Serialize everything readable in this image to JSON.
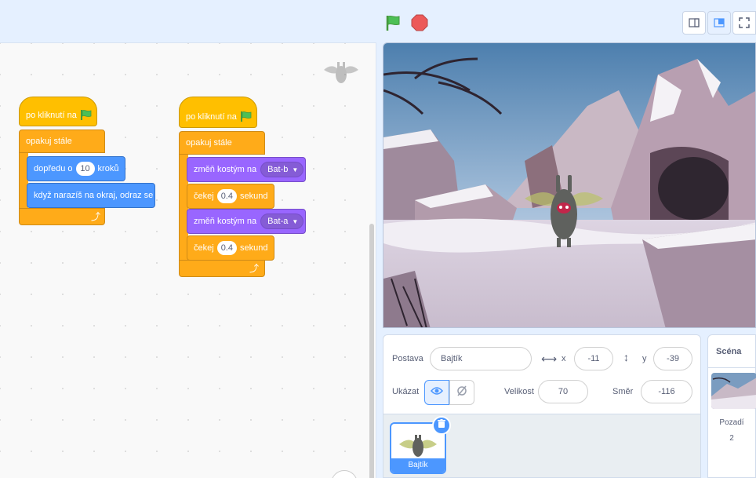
{
  "topbar": {
    "green_flag_icon": "green-flag-icon",
    "stop_icon": "stop-sign-icon",
    "layout_buttons": [
      "small-stage-icon",
      "normal-stage-icon",
      "fullscreen-icon"
    ]
  },
  "scripts": {
    "script1": {
      "hat_label": "po kliknutí na",
      "forever_label": "opakuj stále",
      "move_label_before": "dopředu o",
      "move_value": "10",
      "move_label_after": "kroků",
      "bounce_label": "když narazíš na okraj, odraz se"
    },
    "script2": {
      "hat_label": "po kliknutí na",
      "forever_label": "opakuj stále",
      "switch1_label": "změň kostým na",
      "switch1_value": "Bat-b",
      "wait1_label_before": "čekej",
      "wait1_value": "0.4",
      "wait1_label_after": "sekund",
      "switch2_label": "změň kostým na",
      "switch2_value": "Bat-a",
      "wait2_label_before": "čekej",
      "wait2_value": "0.4",
      "wait2_label_after": "sekund"
    }
  },
  "sprite_info": {
    "sprite_label": "Postava",
    "sprite_name": "Bajtík",
    "x_label": "x",
    "x_value": "-11",
    "y_label": "y",
    "y_value": "-39",
    "show_label": "Ukázat",
    "size_label": "Velikost",
    "size_value": "70",
    "direction_label": "Směr",
    "direction_value": "-116"
  },
  "sprite_list": {
    "items": [
      {
        "name": "Bajtík",
        "selected": true
      }
    ]
  },
  "stage_panel": {
    "title": "Scéna",
    "backdrops_label": "Pozadí",
    "backdrops_count": "2"
  },
  "colors": {
    "events": "#ffbf00",
    "control": "#ffab19",
    "motion": "#4c97ff",
    "looks": "#9966ff",
    "accent": "#4c97ff"
  }
}
